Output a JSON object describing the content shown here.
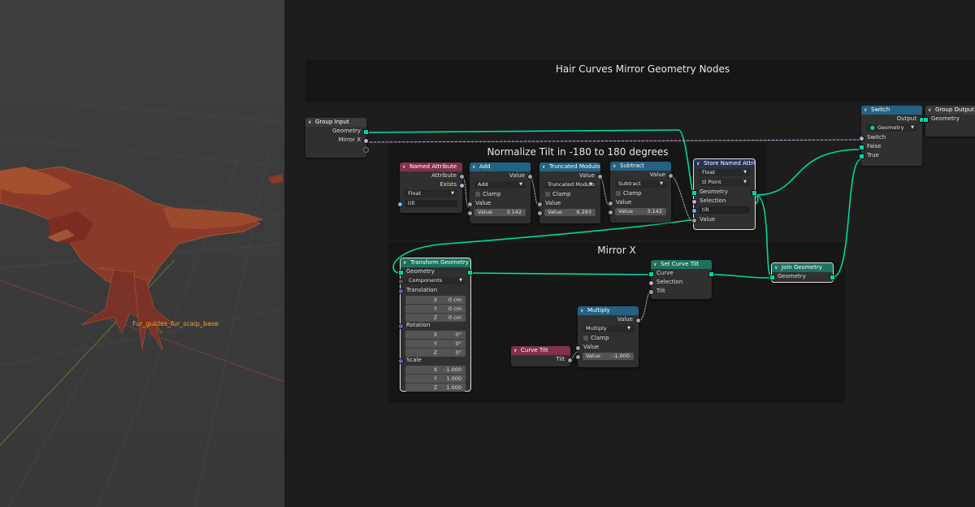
{
  "viewport": {
    "object_label": "Fur_guides_fur_scalp_base"
  },
  "frames": {
    "title": "Hair Curves Mirror Geometry Nodes",
    "normalize": "Normalize Tilt in -180 to 180 degrees",
    "mirror": "Mirror X"
  },
  "nodes": {
    "group_input": {
      "title": "Group Input",
      "geometry": "Geometry",
      "mirror_x": "Mirror X"
    },
    "named_attribute": {
      "title": "Named Attribute",
      "attribute": "Attribute",
      "exists": "Exists",
      "type": "Float",
      "name": "tilt"
    },
    "add": {
      "title": "Add",
      "out": "Value",
      "op": "Add",
      "clamp": "Clamp",
      "in": "Value",
      "value_label": "Value",
      "value": "3.142"
    },
    "trunc_mod": {
      "title": "Truncated Modulo",
      "out": "Value",
      "op": "Truncated Modulo",
      "clamp": "Clamp",
      "in": "Value",
      "value_label": "Value",
      "value": "6.283"
    },
    "subtract": {
      "title": "Subtract",
      "out": "Value",
      "op": "Subtract",
      "clamp": "Clamp",
      "in": "Value",
      "value_label": "Value",
      "value": "3.142"
    },
    "store_named": {
      "title": "Store Named Attri",
      "type": "Float",
      "domain": "Point",
      "geometry": "Geometry",
      "selection": "Selection",
      "name": "tilt",
      "value": "Value"
    },
    "switch": {
      "title": "Switch",
      "output": "Output",
      "type": "Geometry",
      "switch": "Switch",
      "false": "False",
      "true": "True"
    },
    "group_output": {
      "title": "Group Output",
      "geometry": "Geometry"
    },
    "transform": {
      "title": "Transform Geometry",
      "geometry": "Geometry",
      "mode": "Components",
      "translation": "Translation",
      "rotation": "Rotation",
      "scale": "Scale",
      "t": [
        {
          "k": "X",
          "v": "0 cm"
        },
        {
          "k": "Y",
          "v": "0 cm"
        },
        {
          "k": "Z",
          "v": "0 cm"
        }
      ],
      "r": [
        {
          "k": "X",
          "v": "0°"
        },
        {
          "k": "Y",
          "v": "0°"
        },
        {
          "k": "Z",
          "v": "0°"
        }
      ],
      "s": [
        {
          "k": "X",
          "v": "-1.000"
        },
        {
          "k": "Y",
          "v": "1.000"
        },
        {
          "k": "Z",
          "v": "1.000"
        }
      ]
    },
    "set_curve_tilt": {
      "title": "Set Curve Tilt",
      "curve": "Curve",
      "selection": "Selection",
      "tilt": "Tilt"
    },
    "join": {
      "title": "Join Geometry",
      "geometry": "Geometry"
    },
    "multiply": {
      "title": "Multiply",
      "out": "Value",
      "op": "Multiply",
      "clamp": "Clamp",
      "in": "Value",
      "value_label": "Value",
      "value": "-1.000"
    },
    "curve_tilt": {
      "title": "Curve Tilt",
      "tilt": "Tilt"
    }
  },
  "colors": {
    "geometry_wire": "#00d6a3",
    "float_wire": "#a1a1a1",
    "bool_wire": "#cca6d6",
    "viewport_label": "#ff9e2c"
  }
}
